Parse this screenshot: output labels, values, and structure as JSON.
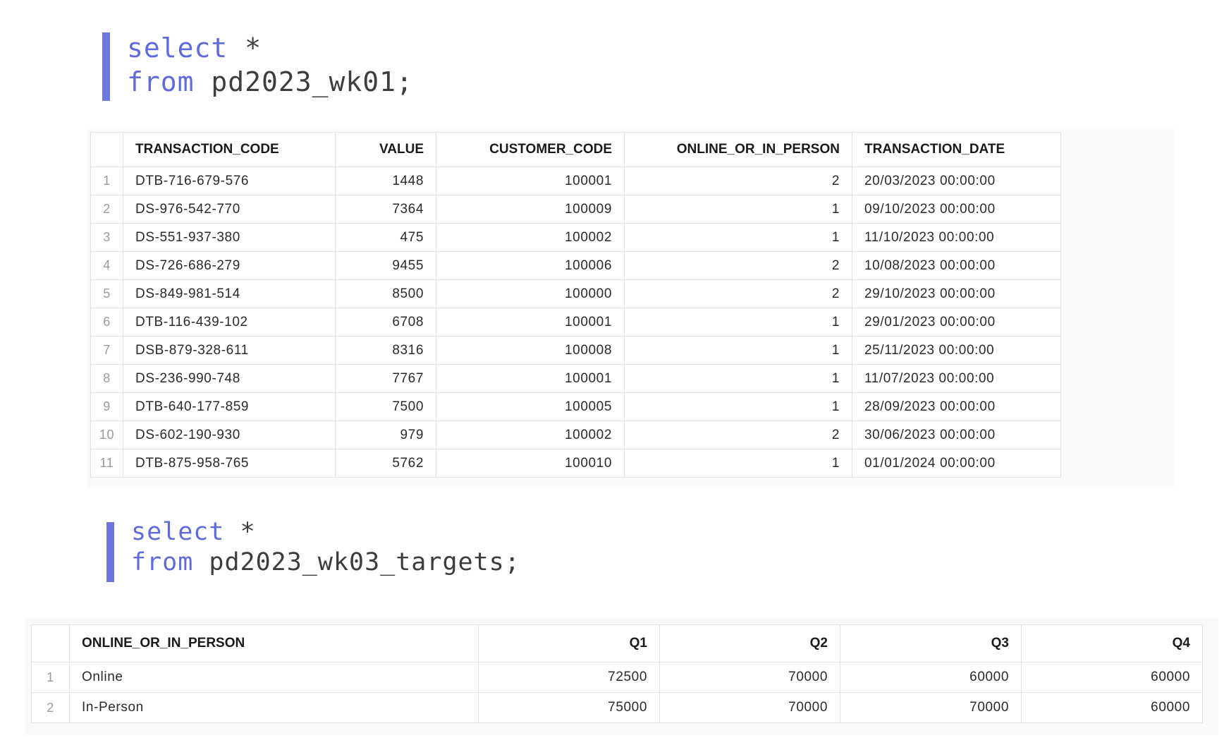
{
  "query1": {
    "keyword_select": "select",
    "select_rest": " *",
    "keyword_from": "from",
    "from_rest": " pd2023_wk01;"
  },
  "table1": {
    "columns": [
      "TRANSACTION_CODE",
      "VALUE",
      "CUSTOMER_CODE",
      "ONLINE_OR_IN_PERSON",
      "TRANSACTION_DATE"
    ],
    "rows": [
      {
        "num": "1",
        "transaction_code": "DTB-716-679-576",
        "value": "1448",
        "customer_code": "100001",
        "online_or_in_person": "2",
        "transaction_date": "20/03/2023 00:00:00"
      },
      {
        "num": "2",
        "transaction_code": "DS-976-542-770",
        "value": "7364",
        "customer_code": "100009",
        "online_or_in_person": "1",
        "transaction_date": "09/10/2023 00:00:00"
      },
      {
        "num": "3",
        "transaction_code": "DS-551-937-380",
        "value": "475",
        "customer_code": "100002",
        "online_or_in_person": "1",
        "transaction_date": "11/10/2023 00:00:00"
      },
      {
        "num": "4",
        "transaction_code": "DS-726-686-279",
        "value": "9455",
        "customer_code": "100006",
        "online_or_in_person": "2",
        "transaction_date": "10/08/2023 00:00:00"
      },
      {
        "num": "5",
        "transaction_code": "DS-849-981-514",
        "value": "8500",
        "customer_code": "100000",
        "online_or_in_person": "2",
        "transaction_date": "29/10/2023 00:00:00"
      },
      {
        "num": "6",
        "transaction_code": "DTB-116-439-102",
        "value": "6708",
        "customer_code": "100001",
        "online_or_in_person": "1",
        "transaction_date": "29/01/2023 00:00:00"
      },
      {
        "num": "7",
        "transaction_code": "DSB-879-328-611",
        "value": "8316",
        "customer_code": "100008",
        "online_or_in_person": "1",
        "transaction_date": "25/11/2023 00:00:00"
      },
      {
        "num": "8",
        "transaction_code": "DS-236-990-748",
        "value": "7767",
        "customer_code": "100001",
        "online_or_in_person": "1",
        "transaction_date": "11/07/2023 00:00:00"
      },
      {
        "num": "9",
        "transaction_code": "DTB-640-177-859",
        "value": "7500",
        "customer_code": "100005",
        "online_or_in_person": "1",
        "transaction_date": "28/09/2023 00:00:00"
      },
      {
        "num": "10",
        "transaction_code": "DS-602-190-930",
        "value": "979",
        "customer_code": "100002",
        "online_or_in_person": "2",
        "transaction_date": "30/06/2023 00:00:00"
      },
      {
        "num": "11",
        "transaction_code": "DTB-875-958-765",
        "value": "5762",
        "customer_code": "100010",
        "online_or_in_person": "1",
        "transaction_date": "01/01/2024 00:00:00"
      }
    ]
  },
  "query2": {
    "keyword_select": "select",
    "select_rest": " *",
    "keyword_from": "from",
    "from_rest": " pd2023_wk03_targets;"
  },
  "table2": {
    "columns": [
      "ONLINE_OR_IN_PERSON",
      "Q1",
      "Q2",
      "Q3",
      "Q4"
    ],
    "rows": [
      {
        "num": "1",
        "online_or_in_person": "Online",
        "q1": "72500",
        "q2": "70000",
        "q3": "60000",
        "q4": "60000"
      },
      {
        "num": "2",
        "online_or_in_person": "In-Person",
        "q1": "75000",
        "q2": "70000",
        "q3": "70000",
        "q4": "60000"
      }
    ]
  },
  "colors": {
    "keyword": "#5f6bdc",
    "code_bar": "#6c76e0"
  }
}
